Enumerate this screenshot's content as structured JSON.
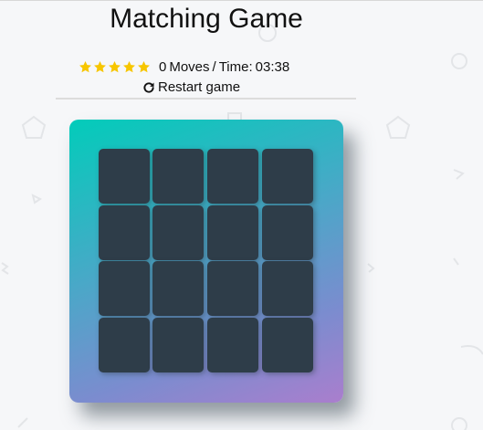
{
  "header": {
    "title": "Matching Game"
  },
  "score_panel": {
    "stars": [
      {
        "icon": "star-icon",
        "color": "#f7c600"
      },
      {
        "icon": "star-icon",
        "color": "#f7c600"
      },
      {
        "icon": "star-icon",
        "color": "#f7c600"
      },
      {
        "icon": "star-icon",
        "color": "#f7c600"
      },
      {
        "icon": "star-icon",
        "color": "#f7c600"
      }
    ],
    "moves_count": "0",
    "moves_label": "Moves",
    "separator": "/",
    "time_label": "Time:",
    "time_value": "03:38",
    "restart_label": "Restart game",
    "restart_icon": "redo-icon"
  },
  "deck": {
    "rows": 4,
    "columns": 4,
    "card_count": 16,
    "cards_face_down": 16,
    "gradient_colors": [
      "#02ccba",
      "#aa7ecd"
    ],
    "card_color": "#2e3d49"
  }
}
